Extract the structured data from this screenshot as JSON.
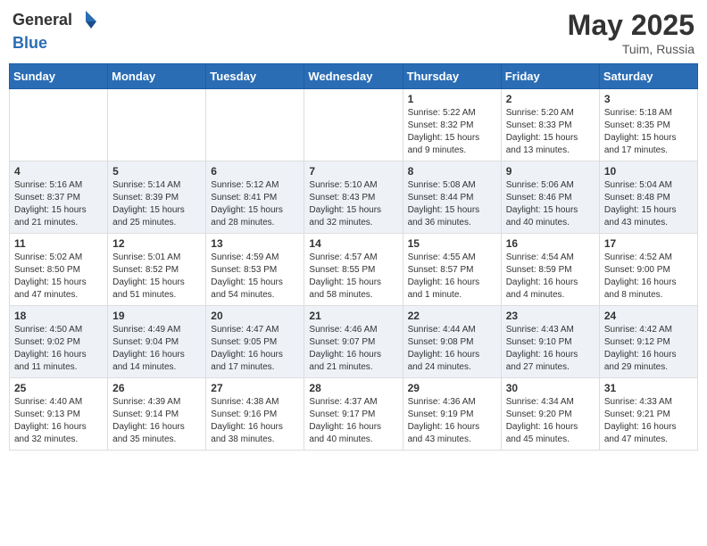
{
  "header": {
    "logo_general": "General",
    "logo_blue": "Blue",
    "month_year": "May 2025",
    "location": "Tuim, Russia"
  },
  "weekdays": [
    "Sunday",
    "Monday",
    "Tuesday",
    "Wednesday",
    "Thursday",
    "Friday",
    "Saturday"
  ],
  "weeks": [
    [
      {
        "day": "",
        "info": ""
      },
      {
        "day": "",
        "info": ""
      },
      {
        "day": "",
        "info": ""
      },
      {
        "day": "",
        "info": ""
      },
      {
        "day": "1",
        "info": "Sunrise: 5:22 AM\nSunset: 8:32 PM\nDaylight: 15 hours\nand 9 minutes."
      },
      {
        "day": "2",
        "info": "Sunrise: 5:20 AM\nSunset: 8:33 PM\nDaylight: 15 hours\nand 13 minutes."
      },
      {
        "day": "3",
        "info": "Sunrise: 5:18 AM\nSunset: 8:35 PM\nDaylight: 15 hours\nand 17 minutes."
      }
    ],
    [
      {
        "day": "4",
        "info": "Sunrise: 5:16 AM\nSunset: 8:37 PM\nDaylight: 15 hours\nand 21 minutes."
      },
      {
        "day": "5",
        "info": "Sunrise: 5:14 AM\nSunset: 8:39 PM\nDaylight: 15 hours\nand 25 minutes."
      },
      {
        "day": "6",
        "info": "Sunrise: 5:12 AM\nSunset: 8:41 PM\nDaylight: 15 hours\nand 28 minutes."
      },
      {
        "day": "7",
        "info": "Sunrise: 5:10 AM\nSunset: 8:43 PM\nDaylight: 15 hours\nand 32 minutes."
      },
      {
        "day": "8",
        "info": "Sunrise: 5:08 AM\nSunset: 8:44 PM\nDaylight: 15 hours\nand 36 minutes."
      },
      {
        "day": "9",
        "info": "Sunrise: 5:06 AM\nSunset: 8:46 PM\nDaylight: 15 hours\nand 40 minutes."
      },
      {
        "day": "10",
        "info": "Sunrise: 5:04 AM\nSunset: 8:48 PM\nDaylight: 15 hours\nand 43 minutes."
      }
    ],
    [
      {
        "day": "11",
        "info": "Sunrise: 5:02 AM\nSunset: 8:50 PM\nDaylight: 15 hours\nand 47 minutes."
      },
      {
        "day": "12",
        "info": "Sunrise: 5:01 AM\nSunset: 8:52 PM\nDaylight: 15 hours\nand 51 minutes."
      },
      {
        "day": "13",
        "info": "Sunrise: 4:59 AM\nSunset: 8:53 PM\nDaylight: 15 hours\nand 54 minutes."
      },
      {
        "day": "14",
        "info": "Sunrise: 4:57 AM\nSunset: 8:55 PM\nDaylight: 15 hours\nand 58 minutes."
      },
      {
        "day": "15",
        "info": "Sunrise: 4:55 AM\nSunset: 8:57 PM\nDaylight: 16 hours\nand 1 minute."
      },
      {
        "day": "16",
        "info": "Sunrise: 4:54 AM\nSunset: 8:59 PM\nDaylight: 16 hours\nand 4 minutes."
      },
      {
        "day": "17",
        "info": "Sunrise: 4:52 AM\nSunset: 9:00 PM\nDaylight: 16 hours\nand 8 minutes."
      }
    ],
    [
      {
        "day": "18",
        "info": "Sunrise: 4:50 AM\nSunset: 9:02 PM\nDaylight: 16 hours\nand 11 minutes."
      },
      {
        "day": "19",
        "info": "Sunrise: 4:49 AM\nSunset: 9:04 PM\nDaylight: 16 hours\nand 14 minutes."
      },
      {
        "day": "20",
        "info": "Sunrise: 4:47 AM\nSunset: 9:05 PM\nDaylight: 16 hours\nand 17 minutes."
      },
      {
        "day": "21",
        "info": "Sunrise: 4:46 AM\nSunset: 9:07 PM\nDaylight: 16 hours\nand 21 minutes."
      },
      {
        "day": "22",
        "info": "Sunrise: 4:44 AM\nSunset: 9:08 PM\nDaylight: 16 hours\nand 24 minutes."
      },
      {
        "day": "23",
        "info": "Sunrise: 4:43 AM\nSunset: 9:10 PM\nDaylight: 16 hours\nand 27 minutes."
      },
      {
        "day": "24",
        "info": "Sunrise: 4:42 AM\nSunset: 9:12 PM\nDaylight: 16 hours\nand 29 minutes."
      }
    ],
    [
      {
        "day": "25",
        "info": "Sunrise: 4:40 AM\nSunset: 9:13 PM\nDaylight: 16 hours\nand 32 minutes."
      },
      {
        "day": "26",
        "info": "Sunrise: 4:39 AM\nSunset: 9:14 PM\nDaylight: 16 hours\nand 35 minutes."
      },
      {
        "day": "27",
        "info": "Sunrise: 4:38 AM\nSunset: 9:16 PM\nDaylight: 16 hours\nand 38 minutes."
      },
      {
        "day": "28",
        "info": "Sunrise: 4:37 AM\nSunset: 9:17 PM\nDaylight: 16 hours\nand 40 minutes."
      },
      {
        "day": "29",
        "info": "Sunrise: 4:36 AM\nSunset: 9:19 PM\nDaylight: 16 hours\nand 43 minutes."
      },
      {
        "day": "30",
        "info": "Sunrise: 4:34 AM\nSunset: 9:20 PM\nDaylight: 16 hours\nand 45 minutes."
      },
      {
        "day": "31",
        "info": "Sunrise: 4:33 AM\nSunset: 9:21 PM\nDaylight: 16 hours\nand 47 minutes."
      }
    ]
  ]
}
